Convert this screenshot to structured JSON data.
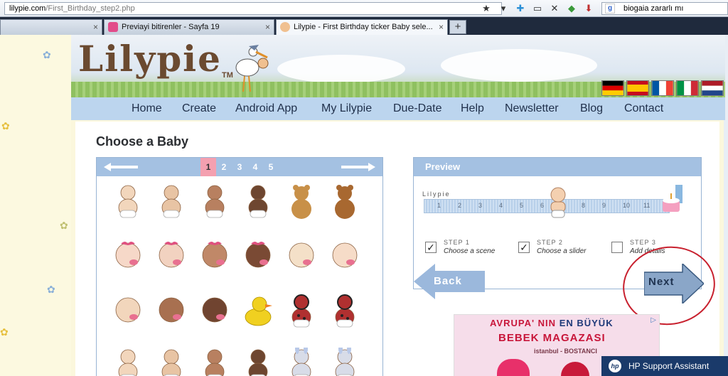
{
  "browser": {
    "url_host": "lilypie.com",
    "url_path": "/First_Birthday_step2.php",
    "search_value": "biogaia zararlı mı",
    "tabs": [
      {
        "title": ""
      },
      {
        "title": "Previayi bitirenler - Sayfa 19"
      },
      {
        "title": "Lilypie - First Birthday ticker Baby sele..."
      }
    ],
    "new_tab_label": "+",
    "close_glyph": "×"
  },
  "site": {
    "logo": "Lilypie",
    "tm": "TM",
    "nav": [
      "Home",
      "Create",
      "Android App",
      "My Lilypie",
      "Due-Date",
      "Help",
      "Newsletter",
      "Blog",
      "Contact"
    ],
    "flags": [
      "german-flag",
      "spanish-flag",
      "french-flag",
      "italian-flag",
      "dutch-flag"
    ]
  },
  "chooser": {
    "title": "Choose a Baby",
    "pages": [
      "1",
      "2",
      "3",
      "4",
      "5"
    ],
    "current_page": "1"
  },
  "preview": {
    "title": "Preview",
    "ticker_label": "Lilypie",
    "ticks": [
      "1",
      "2",
      "3",
      "4",
      "5",
      "6",
      "7",
      "8",
      "9",
      "10",
      "11"
    ],
    "steps": [
      {
        "num": "STEP 1",
        "text": "Choose a scene",
        "checked": true
      },
      {
        "num": "STEP 2",
        "text": "Choose a slider",
        "checked": true
      },
      {
        "num": "STEP 3",
        "text": "Add details",
        "checked": false
      }
    ],
    "back_label": "Back",
    "next_label": "Next",
    "check_glyph": "✓"
  },
  "ad": {
    "line1_a": "AVRUPA' NIN",
    "line1_b": "EN BÜYÜK",
    "line2": "BEBEK MAGAZASI",
    "line3": "istanbul - BOSTANCI"
  },
  "taskbar": {
    "hp_label": "HP Support Assistant",
    "hp_logo": "hp"
  },
  "colors": {
    "nav_bg": "#bcd5ee",
    "panel_head": "#a4c1e2",
    "current_page": "#f4a0b0",
    "annotation_circle": "#c8202e"
  }
}
